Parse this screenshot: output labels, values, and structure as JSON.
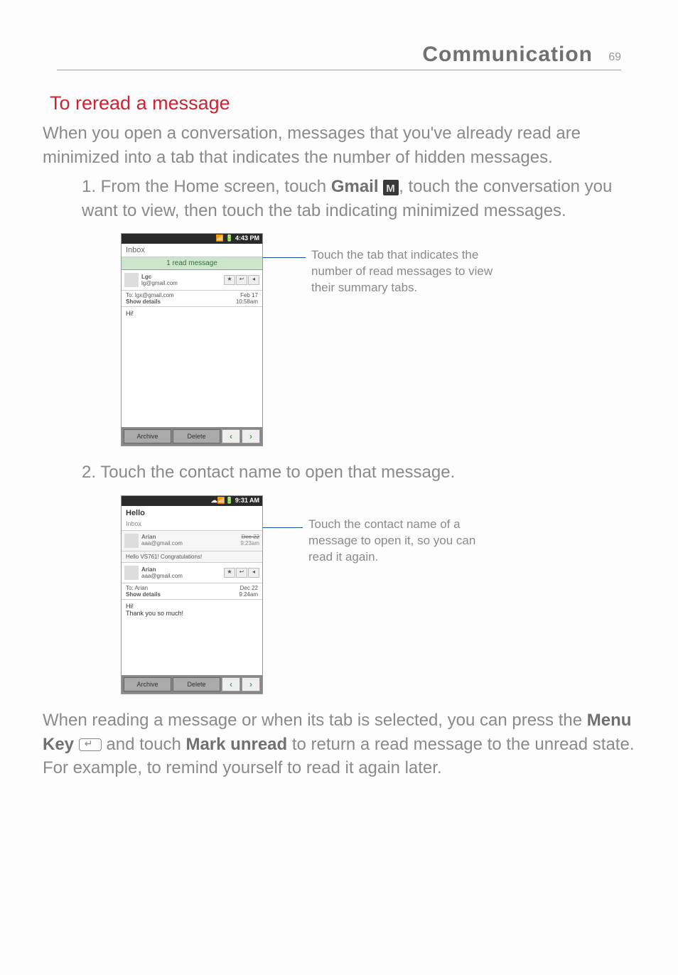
{
  "header": {
    "title": "Communication",
    "page_number": "69"
  },
  "section": {
    "title": "To reread a message",
    "intro": "When you open a conversation, messages that you've already read are minimized into a tab that indicates the number of hidden messages.",
    "step1_prefix": "1. From the Home screen, touch ",
    "step1_gmail": "Gmail",
    "step1_mid": ", touch the conversation you want to view, then touch the tab indicating minimized messages.",
    "step2": "2. Touch the contact name to open that message.",
    "footer_prefix": "When reading a message or when its tab is selected, you can press the ",
    "footer_menukey": "Menu Key",
    "footer_mid": " and touch ",
    "footer_markunread": "Mark unread",
    "footer_end": " to return a read message to the unread state. For example, to remind yourself to read it again later."
  },
  "screenshot1": {
    "status_time": "4:43 PM",
    "inbox": "Inbox",
    "read_tab": "1 read message",
    "sender_name": "Lgc",
    "sender_email": "lg@gmail.com",
    "to_line": "To: lgx@gmail.com",
    "show_details": "Show details",
    "date": "Feb 17",
    "time": "10:58am",
    "body": "Hi!",
    "archive": "Archive",
    "delete": "Delete",
    "prev": "‹",
    "next": "›",
    "star": "★",
    "reply": "↩",
    "down": "◂",
    "callout": "Touch the tab that indicates the number of read messages to view their summary tabs."
  },
  "screenshot2": {
    "status_time": "9:31 AM",
    "hello": "Hello",
    "inbox": "Inbox",
    "contact1_name": "Arian",
    "contact1_email": "aaa@gmail.com",
    "contact1_date": "Dec 22",
    "contact1_time": "9:23am",
    "congrats": "Hello VS761! Congratulations!",
    "contact2_name": "Arian",
    "contact2_email": "aaa@gmail.com",
    "to_line": "To: Arian",
    "show_details": "Show details",
    "date2": "Dec 22",
    "time2": "9:24am",
    "body": "Hi!\nThank you so much!",
    "archive": "Archive",
    "delete": "Delete",
    "callout": "Touch the contact name of a message to open it, so you can read it again."
  }
}
